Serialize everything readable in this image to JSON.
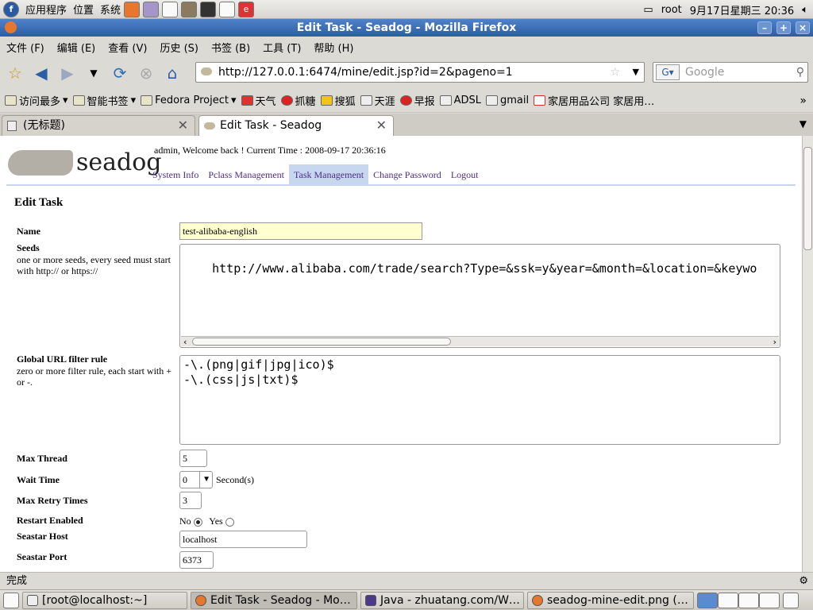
{
  "top_panel": {
    "apps": "应用程序",
    "places": "位置",
    "system": "系统",
    "user": "root",
    "datetime": "9月17日星期三 20:36"
  },
  "window": {
    "title": "Edit Task - Seadog - Mozilla Firefox"
  },
  "menu": [
    "文件 (F)",
    "编辑 (E)",
    "查看 (V)",
    "历史 (S)",
    "书签 (B)",
    "工具 (T)",
    "帮助 (H)"
  ],
  "nav": {
    "url": "http://127.0.0.1:6474/mine/edit.jsp?id=2&pageno=1",
    "search_placeholder": "Google"
  },
  "bookmarks": [
    "访问最多",
    "智能书签",
    "Fedora Project",
    "天气",
    "抓糖",
    "搜狐",
    "天涯",
    "早报",
    "ADSL",
    "gmail",
    "家居用品公司 家居用…"
  ],
  "tabs": [
    {
      "label": "(无标题)",
      "active": false
    },
    {
      "label": "Edit Task - Seadog",
      "active": true
    }
  ],
  "page": {
    "logo_text": "seadog",
    "welcome": "admin, Welcome back ! Current Time : 2008-09-17 20:36:16",
    "nav_links": [
      "System Info",
      "Pclass Management",
      "Task Management",
      "Change Password",
      "Logout"
    ],
    "heading": "Edit Task",
    "fields": {
      "name": {
        "label": "Name",
        "value": "test-alibaba-english"
      },
      "seeds": {
        "label": "Seeds",
        "hint": "one or more seeds, every seed must start with http:// or https://",
        "value": "http://www.alibaba.com/trade/search?Type=&ssk=y&year=&month=&location=&keywo"
      },
      "filter": {
        "label": "Global URL filter rule",
        "hint": "zero or more filter rule, each start with + or -.",
        "value": "-\\.(png|gif|jpg|ico)$\n-\\.(css|js|txt)$"
      },
      "max_thread": {
        "label": "Max Thread",
        "value": "5"
      },
      "wait_time": {
        "label": "Wait Time",
        "value": "0",
        "unit": "Second(s)"
      },
      "max_retry": {
        "label": "Max Retry Times",
        "value": "3"
      },
      "restart": {
        "label": "Restart Enabled",
        "no": "No",
        "yes": "Yes",
        "selected": "No"
      },
      "seastar_host": {
        "label": "Seastar Host",
        "value": "localhost"
      },
      "seastar_port": {
        "label": "Seastar Port",
        "value": "6373"
      }
    }
  },
  "status": "完成",
  "taskbar": [
    "[root@localhost:~]",
    "Edit Task - Seadog - Mo…",
    "Java - zhuatang.com/W…",
    "seadog-mine-edit.png (…"
  ]
}
